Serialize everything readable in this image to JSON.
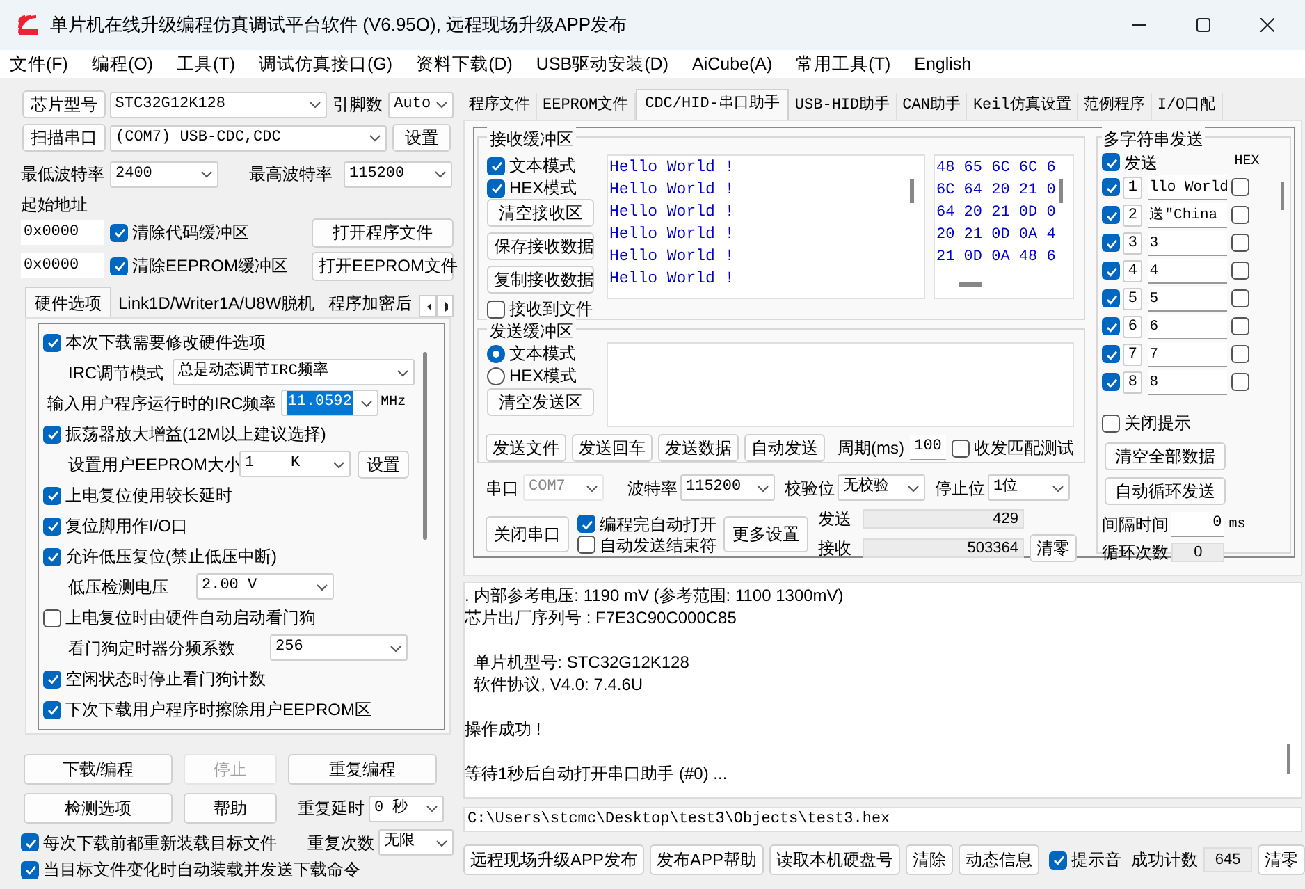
{
  "window": {
    "title": "单片机在线升级编程仿真调试平台软件 (V6.95O), 远程现场升级APP发布"
  },
  "menu": [
    "文件(F)",
    "编程(O)",
    "工具(T)",
    "调试仿真接口(G)",
    "资料下载(D)",
    "USB驱动安装(D)",
    "AiCube(A)",
    "常用工具(T)",
    "English"
  ],
  "chip": {
    "button": "芯片型号",
    "value": "STC32G12K128",
    "pins_label": "引脚数",
    "pins_value": "Auto"
  },
  "port": {
    "scan_button": "扫描串口",
    "value": "(COM7) USB-CDC,CDC",
    "settings_button": "设置"
  },
  "baud": {
    "min_label": "最低波特率",
    "min_value": "2400",
    "max_label": "最高波特率",
    "max_value": "115200"
  },
  "start_address": {
    "label": "起始地址",
    "rows": [
      {
        "address": "0x0000",
        "label": "清除代码缓冲区",
        "checked": true,
        "button": "打开程序文件"
      },
      {
        "address": "0x0000",
        "label": "清除EEPROM缓冲区",
        "checked": true,
        "button": "打开EEPROM文件"
      }
    ]
  },
  "left_tabs": [
    {
      "label": "硬件选项",
      "selected": true
    },
    {
      "label": "Link1D/Writer1A/U8W脱机",
      "selected": false
    },
    {
      "label": "程序加密后",
      "selected": false
    }
  ],
  "hardware_options": [
    {
      "kind": "checkbox",
      "label": "本次下载需要修改硬件选项",
      "checked": true
    },
    {
      "kind": "select",
      "label": "IRC调节模式",
      "value": "总是动态调节IRC频率"
    },
    {
      "kind": "select",
      "label": "输入用户程序运行时的IRC频率",
      "value": "11.0592",
      "highlighted": true,
      "unit": "MHz"
    },
    {
      "kind": "checkbox",
      "label": "振荡器放大增益(12M以上建议选择)",
      "checked": true
    },
    {
      "kind": "select",
      "label": "设置用户EEPROM大小",
      "value": "1    K",
      "button": "设置"
    },
    {
      "kind": "checkbox",
      "label": "上电复位使用较长延时",
      "checked": true
    },
    {
      "kind": "checkbox",
      "label": "复位脚用作I/O口",
      "checked": true
    },
    {
      "kind": "checkbox",
      "label": "允许低压复位(禁止低压中断)",
      "checked": true
    },
    {
      "kind": "select",
      "label": "低压检测电压",
      "value": "2.00 V"
    },
    {
      "kind": "checkbox",
      "label": "上电复位时由硬件自动启动看门狗",
      "checked": false
    },
    {
      "kind": "select",
      "label": "看门狗定时器分频系数",
      "value": "256"
    },
    {
      "kind": "checkbox",
      "label": "空闲状态时停止看门狗计数",
      "checked": true
    },
    {
      "kind": "checkbox",
      "label": "下次下载用户程序时擦除用户EEPROM区",
      "checked": true
    }
  ],
  "program_buttons": [
    {
      "label": "下载/编程",
      "disabled": false
    },
    {
      "label": "停止",
      "disabled": true
    },
    {
      "label": "重复编程",
      "disabled": false
    },
    {
      "label": "检测选项",
      "disabled": false
    },
    {
      "label": "帮助",
      "disabled": false
    }
  ],
  "repeat_delay": {
    "label": "重复延时",
    "value": "0 秒"
  },
  "repeat_count": {
    "label": "重复次数",
    "value": "无限"
  },
  "auto_options": [
    {
      "label": "每次下载前都重新装载目标文件",
      "checked": true
    },
    {
      "label": "当目标文件变化时自动装载并发送下载命令",
      "checked": true
    }
  ],
  "right_tabs": [
    {
      "label": "程序文件",
      "selected": false
    },
    {
      "label": "EEPROM文件",
      "selected": false
    },
    {
      "label": "CDC/HID-串口助手",
      "selected": true
    },
    {
      "label": "USB-HID助手",
      "selected": false
    },
    {
      "label": "CAN助手",
      "selected": false
    },
    {
      "label": "Keil仿真设置",
      "selected": false
    },
    {
      "label": "范例程序",
      "selected": false
    },
    {
      "label": "I/O口配",
      "selected": false
    }
  ],
  "receive": {
    "title": "接收缓冲区",
    "options": [
      {
        "label": "文本模式",
        "checked": true
      },
      {
        "label": "HEX模式",
        "checked": true
      }
    ],
    "buttons": [
      "清空接收区",
      "保存接收数据",
      "复制接收数据"
    ],
    "to_file": {
      "label": "接收到文件",
      "checked": false
    },
    "text_lines": [
      "Hello World !",
      "Hello World !",
      "Hello World !",
      "Hello World !",
      "Hello World !",
      "Hello World !"
    ],
    "hex_lines": [
      "48 65 6C 6C 6",
      "6C 64 20 21 0",
      "64 20 21 0D 0",
      "20 21 0D 0A 4",
      "21 0D 0A 48 6"
    ]
  },
  "send": {
    "title": "发送缓冲区",
    "modes": [
      {
        "label": "文本模式",
        "selected": true
      },
      {
        "label": "HEX模式",
        "selected": false
      }
    ],
    "clear_button": "清空发送区",
    "buttons": [
      "发送文件",
      "发送回车",
      "发送数据",
      "自动发送"
    ],
    "period_label": "周期(ms)",
    "period_value": "100",
    "match_test": {
      "label": "收发匹配测试",
      "checked": false
    }
  },
  "serial": {
    "port_label": "串口",
    "port_value": "COM7",
    "port_disabled": true,
    "baud_label": "波特率",
    "baud_value": "115200",
    "parity_label": "校验位",
    "parity_value": "无校验",
    "stop_label": "停止位",
    "stop_value": "1位",
    "close_button": "关闭串口",
    "options": [
      {
        "label": "编程完自动打开",
        "checked": true
      },
      {
        "label": "自动发送结束符",
        "checked": false
      }
    ],
    "more_button": "更多设置",
    "sent_label": "发送",
    "sent_value": "429",
    "received_label": "接收",
    "received_value": "503364",
    "reset_button": "清零"
  },
  "multi_send": {
    "title": "多字符串发送",
    "send_header": {
      "label": "发送",
      "checked": true
    },
    "hex_header": "HEX",
    "rows": [
      {
        "number": "1",
        "value": "llo World",
        "checked": true,
        "hex": false
      },
      {
        "number": "2",
        "value": "送\"China",
        "checked": true,
        "hex": false
      },
      {
        "number": "3",
        "value": "3",
        "checked": true,
        "hex": false
      },
      {
        "number": "4",
        "value": "4",
        "checked": true,
        "hex": false
      },
      {
        "number": "5",
        "value": "5",
        "checked": true,
        "hex": false
      },
      {
        "number": "6",
        "value": "6",
        "checked": true,
        "hex": false
      },
      {
        "number": "7",
        "value": "7",
        "checked": true,
        "hex": false
      },
      {
        "number": "8",
        "value": "8",
        "checked": true,
        "hex": false
      }
    ],
    "close_hint": {
      "label": "关闭提示",
      "checked": false
    },
    "buttons": [
      "清空全部数据",
      "自动循环发送"
    ],
    "interval_label": "间隔时间",
    "interval_value": "0",
    "interval_unit": "ms",
    "loop_label": "循环次数",
    "loop_value": "0"
  },
  "log": {
    "paragraphs": [
      [
        ". 内部参考电压: 1190 mV (参考范围: 1100 1300mV)",
        "芯片出厂序列号 : F7E3C90C000C85"
      ],
      [
        "  单片机型号: STC32G12K128",
        "  软件协议, V4.0: 7.4.6U"
      ],
      [
        "操作成功 !"
      ],
      [
        "等待1秒后自动打开串口助手 (#0) ..."
      ]
    ]
  },
  "file_path": "C:\\Users\\stcmc\\Desktop\\test3\\Objects\\test3.hex",
  "bottom_bar": {
    "buttons": [
      "远程现场升级APP发布",
      "发布APP帮助",
      "读取本机硬盘号",
      "清除",
      "动态信息"
    ],
    "sound": {
      "label": "提示音",
      "checked": true
    },
    "count_label": "成功计数",
    "count_value": "645",
    "reset_button": "清零"
  }
}
